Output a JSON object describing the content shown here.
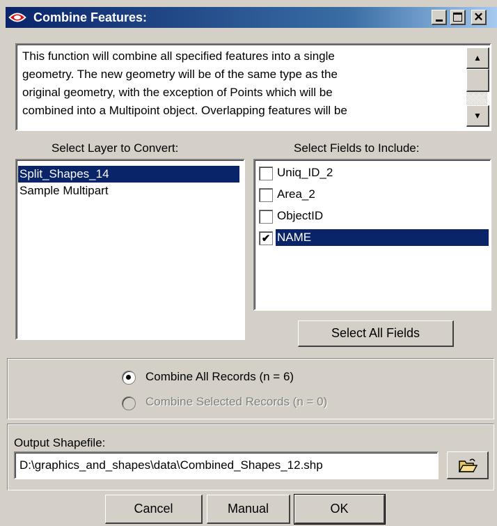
{
  "window": {
    "title": "Combine Features:",
    "controls": [
      "minimize-icon",
      "maximize-icon",
      "close-icon"
    ]
  },
  "description": "This function will combine all specified features into a single\ngeometry.  The new geometry will be of the same type as the\noriginal geometry, with the exception of Points which will be\ncombined into a Multipoint object.  Overlapping features will be",
  "layers": {
    "label": "Select Layer to Convert:",
    "items": [
      "Split_Shapes_14",
      "Sample Multipart"
    ],
    "selected": "Split_Shapes_14"
  },
  "fields": {
    "label": "Select Fields to Include:",
    "items": [
      {
        "name": "Uniq_ID_2",
        "checked": false
      },
      {
        "name": "Area_2",
        "checked": false
      },
      {
        "name": "ObjectID",
        "checked": false
      },
      {
        "name": "NAME",
        "checked": true
      }
    ],
    "select_all_label": "Select All Fields"
  },
  "records": {
    "all_label": "Combine All Records (n = 6)",
    "selected_label": "Combine Selected Records (n = 0)",
    "choice": "all"
  },
  "output": {
    "label": "Output Shapefile:",
    "value": "D:\\graphics_and_shapes\\data\\Combined_Shapes_12.shp",
    "browse_icon": "folder-open-icon"
  },
  "buttons": {
    "cancel": "Cancel",
    "manual": "Manual",
    "ok": "OK"
  }
}
